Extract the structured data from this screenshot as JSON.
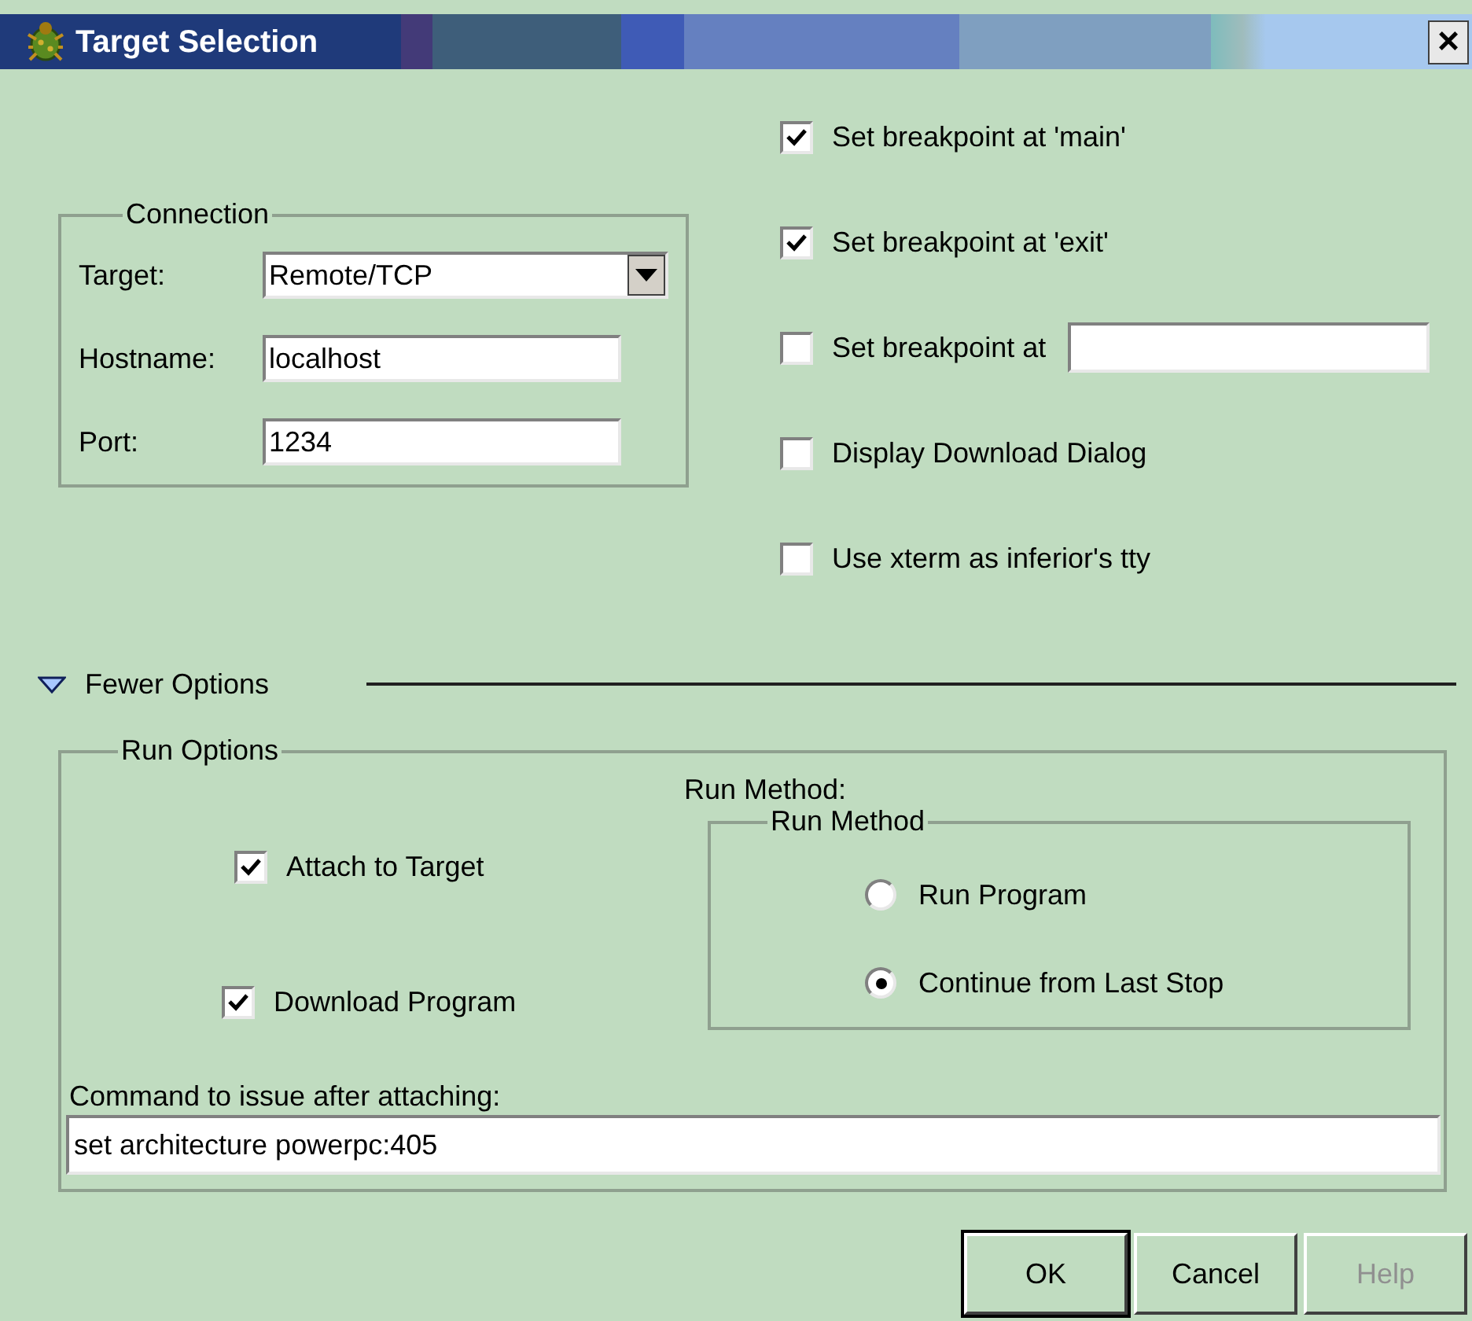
{
  "window": {
    "title": "Target Selection",
    "close": "×"
  },
  "connection": {
    "legend": "Connection",
    "fields": [
      {
        "kind": "dropdown",
        "label": "Target:",
        "value": "Remote/TCP"
      },
      {
        "kind": "text",
        "label": "Hostname:",
        "value": "localhost"
      },
      {
        "kind": "text",
        "label": "Port:",
        "value": "1234"
      }
    ]
  },
  "breakpoints": [
    {
      "kind": "checkbox",
      "label": "Set breakpoint at 'main'",
      "checked": true
    },
    {
      "kind": "checkbox",
      "label": "Set breakpoint at 'exit'",
      "checked": true
    },
    {
      "kind": "checkbox_field",
      "label": "Set breakpoint at",
      "checked": false
    },
    {
      "kind": "checkbox",
      "label": "Display Download Dialog",
      "checked": false
    },
    {
      "kind": "checkbox",
      "label": "Use xterm as inferior's tty",
      "checked": false
    }
  ],
  "options_toggle": {
    "label": "Fewer Options",
    "expanded": true
  },
  "run_options": {
    "legend": "Run Options",
    "run_method_label": "Run Method:",
    "attach": {
      "label": "Attach to Target",
      "checked": true
    },
    "download": {
      "label": "Download Program",
      "checked": true
    },
    "run_method": {
      "legend": "Run Method",
      "options": [
        {
          "label": "Run Program",
          "selected": false
        },
        {
          "label": "Continue from Last Stop",
          "selected": true
        }
      ]
    },
    "command": {
      "label": "Command to issue after attaching:",
      "value": "set architecture powerpc:405"
    }
  },
  "buttons": [
    {
      "label": "OK",
      "default": true,
      "disabled": false
    },
    {
      "label": "Cancel",
      "default": false,
      "disabled": false
    },
    {
      "label": "Help",
      "default": false,
      "disabled": true
    }
  ]
}
